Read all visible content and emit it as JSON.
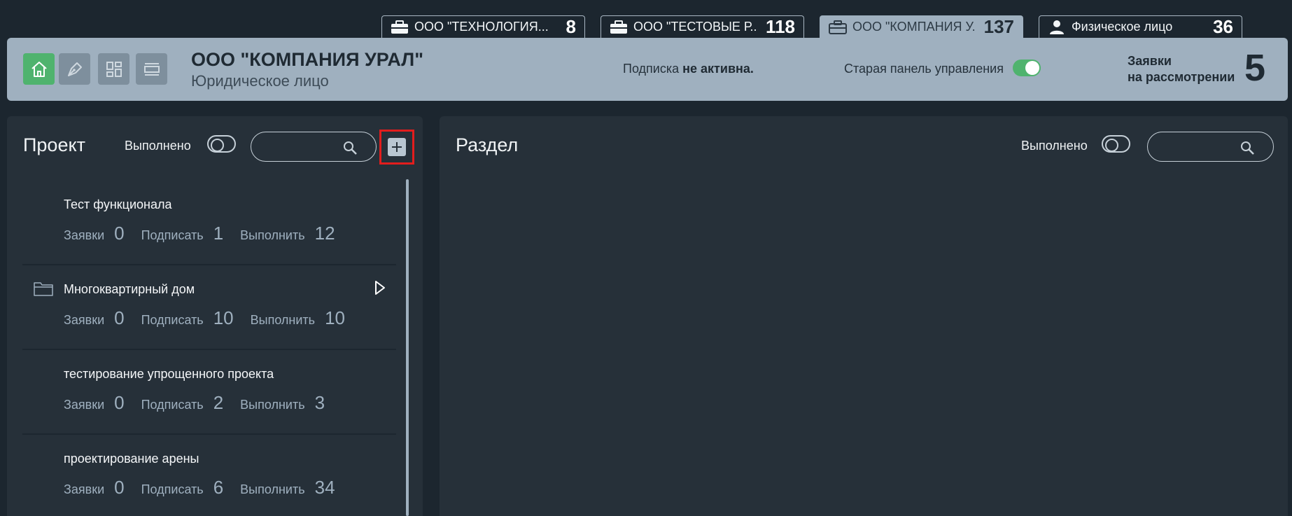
{
  "tabs": [
    {
      "label": "ООО \"ТЕХНОЛОГИЯ...",
      "count": "8",
      "icon": "briefcase-icon",
      "active": false
    },
    {
      "label": "ООО \"ТЕСТОВЫЕ Р...",
      "count": "118",
      "icon": "briefcase-icon",
      "active": false
    },
    {
      "label": "ООО \"КОМПАНИЯ У...",
      "count": "137",
      "icon": "briefcase-icon",
      "active": true
    },
    {
      "label": "Физическое лицо",
      "count": "36",
      "icon": "person-icon",
      "active": false
    }
  ],
  "header": {
    "company_name": "ООО \"КОМПАНИЯ УРАЛ\"",
    "company_type": "Юридическое лицо",
    "subscription_label": "Подписка",
    "subscription_status": "не активна.",
    "old_panel_label": "Старая панель управления",
    "requests_line1": "Заявки",
    "requests_line2": "на рассмотрении",
    "requests_count": "5"
  },
  "left_panel": {
    "title": "Проект",
    "done_label": "Выполнено",
    "search_placeholder": "",
    "projects": [
      {
        "name": "Тест функционала",
        "folder": false,
        "stats": [
          {
            "label": "Заявки",
            "value": "0"
          },
          {
            "label": "Подписать",
            "value": "1"
          },
          {
            "label": "Выполнить",
            "value": "12"
          }
        ]
      },
      {
        "name": "Многоквартирный дом",
        "folder": true,
        "stats": [
          {
            "label": "Заявки",
            "value": "0"
          },
          {
            "label": "Подписать",
            "value": "10"
          },
          {
            "label": "Выполнить",
            "value": "10"
          }
        ]
      },
      {
        "name": "тестирование упрощенного проекта",
        "folder": false,
        "stats": [
          {
            "label": "Заявки",
            "value": "0"
          },
          {
            "label": "Подписать",
            "value": "2"
          },
          {
            "label": "Выполнить",
            "value": "3"
          }
        ]
      },
      {
        "name": "проектирование арены",
        "folder": false,
        "stats": [
          {
            "label": "Заявки",
            "value": "0"
          },
          {
            "label": "Подписать",
            "value": "6"
          },
          {
            "label": "Выполнить",
            "value": "34"
          }
        ]
      }
    ]
  },
  "right_panel": {
    "title": "Раздел",
    "done_label": "Выполнено",
    "search_placeholder": ""
  },
  "colors": {
    "accent_green": "#4fb36e",
    "highlight_red": "#e21d1d",
    "header_bg": "#9fb0bf",
    "panel_bg": "#263039"
  }
}
